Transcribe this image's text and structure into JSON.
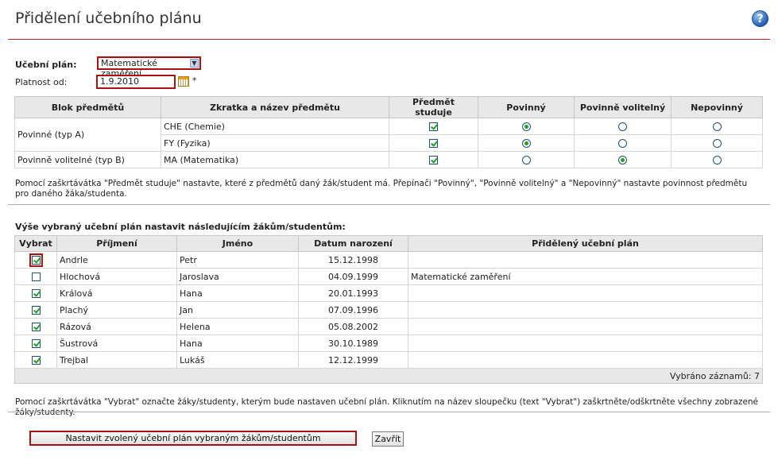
{
  "page": {
    "title": "Přidělení učebního plánu"
  },
  "help_icon": {
    "icon": "help-icon",
    "glyph": "?"
  },
  "form": {
    "plan_label": "Učební plán:",
    "plan_value": "Matematické zaměření",
    "valid_from_label": "Platnost od:",
    "valid_from_value": "1.9.2010",
    "required_mark": "*"
  },
  "subjects_table": {
    "headers": [
      "Blok předmětů",
      "Zkratka a název předmětu",
      "Předmět studuje",
      "Povinný",
      "Povinně volitelný",
      "Nepovinný"
    ],
    "blocks": [
      {
        "name": "Povinné (typ A)"
      },
      {
        "name": "Povinně volitelné (typ B)"
      }
    ],
    "rows": [
      {
        "subject": "CHE (Chemie)",
        "studies": true,
        "choice": "Povinný"
      },
      {
        "subject": "FY (Fyzika)",
        "studies": true,
        "choice": "Povinný"
      },
      {
        "subject": "MA (Matematika)",
        "studies": true,
        "choice": "Povinně volitelný"
      }
    ]
  },
  "note1": "Pomocí zaškrtávátka \"Předmět studuje\" nastavte, které z předmětů daný žák/student má. Přepínači \"Povinný\", \"Povinně volitelný\" a \"Nepovinný\" nastavte povinnost předmětu pro daného žáka/studenta.",
  "students_section": {
    "heading": "Výše vybraný učební plán nastavit následujícím žákům/studentům:",
    "headers": [
      "Vybrat",
      "Příjmení",
      "Jméno",
      "Datum narození",
      "Přidělený učební plán"
    ],
    "rows": [
      {
        "selected": true,
        "surname": "Andrle",
        "name": "Petr",
        "birth": "15.12.1998",
        "plan": ""
      },
      {
        "selected": false,
        "surname": "Hlochová",
        "name": "Jaroslava",
        "birth": "04.09.1999",
        "plan": "Matematické zaměření"
      },
      {
        "selected": true,
        "surname": "Králová",
        "name": "Hana",
        "birth": "20.01.1993",
        "plan": ""
      },
      {
        "selected": true,
        "surname": "Plachý",
        "name": "Jan",
        "birth": "07.09.1996",
        "plan": ""
      },
      {
        "selected": true,
        "surname": "Rázová",
        "name": "Helena",
        "birth": "05.08.2002",
        "plan": ""
      },
      {
        "selected": true,
        "surname": "Šustrová",
        "name": "Hana",
        "birth": "30.10.1989",
        "plan": ""
      },
      {
        "selected": true,
        "surname": "Trejbal",
        "name": "Lukáš",
        "birth": "12.12.1999",
        "plan": ""
      }
    ],
    "footer": "Vybráno záznamů: 7"
  },
  "note2": "Pomocí zaškrtávátka \"Vybrat\" označte žáky/studenty, kterým bude nastaven učební plán. Kliknutím na název sloupečku (text \"Vybrat\") zaškrtněte/odškrtněte všechny zobrazené žáky/studenty.",
  "buttons": {
    "apply": "Nastavit zvolený učební plán vybraným žákům/studentům",
    "close": "Zavřít"
  },
  "colors": {
    "accent_red": "#aa1111",
    "check_green": "#21a121",
    "header_gray": "#e8e8e8"
  }
}
